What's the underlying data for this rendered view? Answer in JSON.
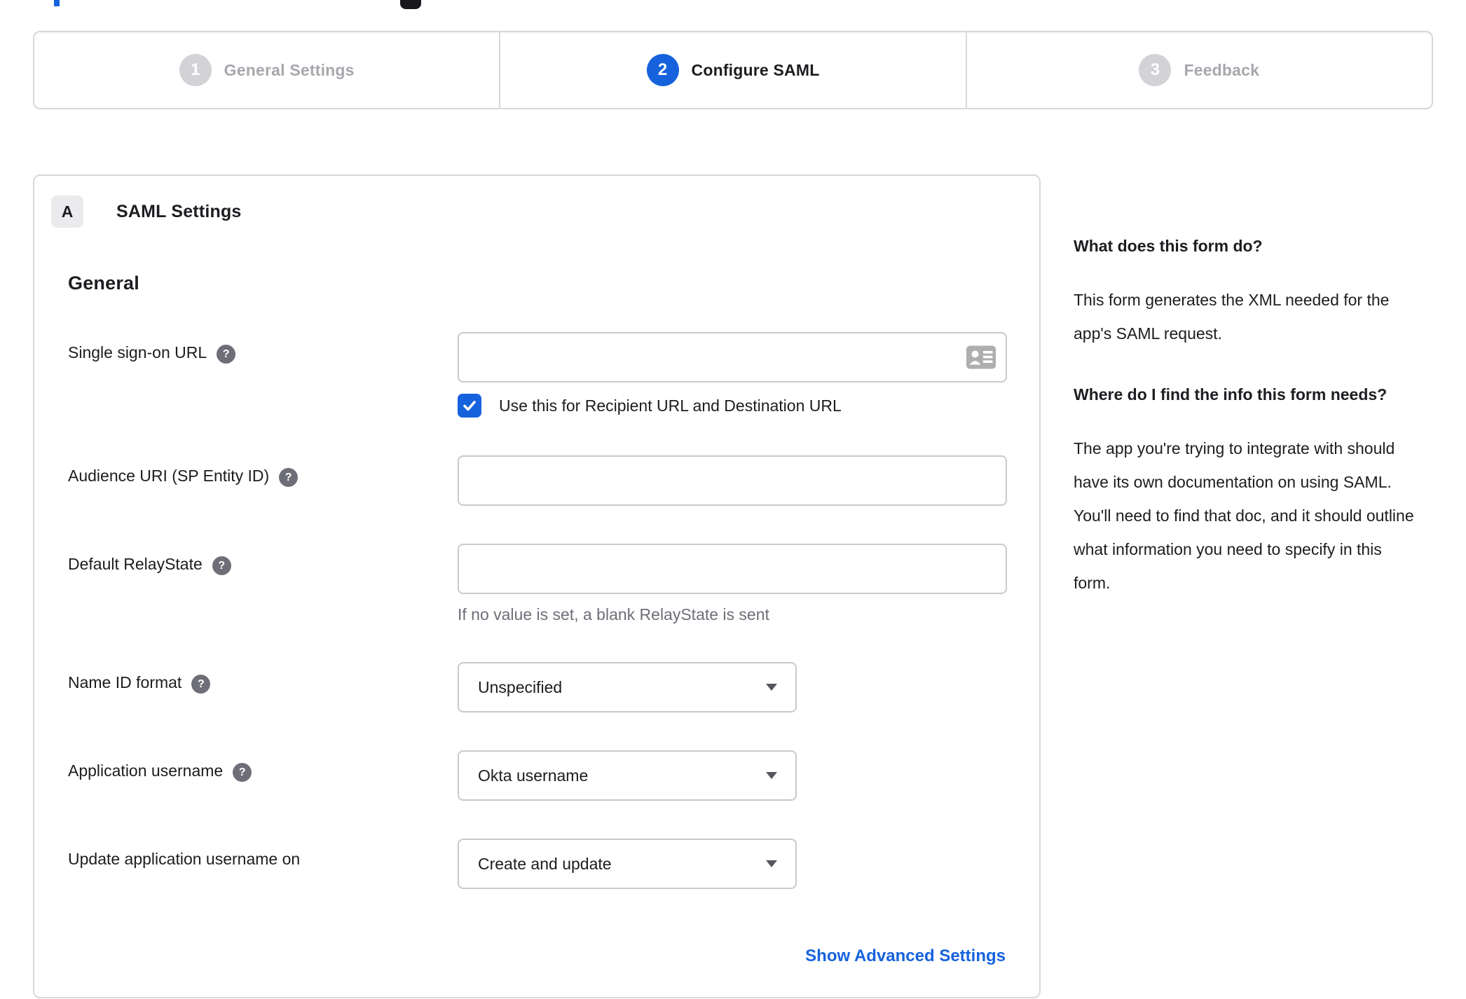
{
  "colors": {
    "accent_blue": "#1662dd",
    "text_dark": "#1d1d21",
    "text_gray": "#6e6e78",
    "inactive_gray": "#a7a7ad",
    "border": "#d8d8d8"
  },
  "icons": {
    "help_glyph": "?"
  },
  "stepper": {
    "steps": [
      {
        "number": "1",
        "label": "General Settings",
        "state": "inactive"
      },
      {
        "number": "2",
        "label": "Configure SAML",
        "state": "active"
      },
      {
        "number": "3",
        "label": "Feedback",
        "state": "inactive"
      }
    ]
  },
  "panel": {
    "section_letter": "A",
    "section_title": "SAML Settings",
    "heading": "General",
    "fields": {
      "sso": {
        "label": "Single sign-on URL",
        "value": "",
        "checkbox_label": "Use this for Recipient URL and Destination URL",
        "checkbox_checked": true
      },
      "audience": {
        "label": "Audience URI (SP Entity ID)",
        "value": ""
      },
      "relay": {
        "label": "Default RelayState",
        "value": "",
        "hint": "If no value is set, a blank RelayState is sent"
      },
      "nameid": {
        "label": "Name ID format",
        "value": "Unspecified"
      },
      "appuser": {
        "label": "Application username",
        "value": "Okta username"
      },
      "updateuser": {
        "label": "Update application username on",
        "value": "Create and update"
      }
    },
    "advanced_link": "Show Advanced Settings"
  },
  "help": {
    "q1": "What does this form do?",
    "a1": "This form generates the XML needed for the app's SAML request.",
    "q2": "Where do I find the info this form needs?",
    "a2": "The app you're trying to integrate with should have its own documentation on using SAML. You'll need to find that doc, and it should outline what information you need to specify in this form."
  }
}
